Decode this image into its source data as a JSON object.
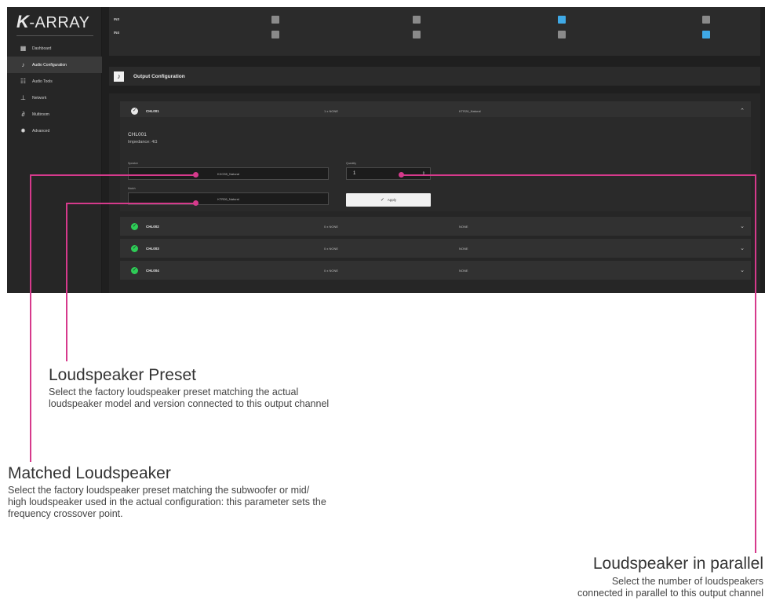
{
  "brand": {
    "logo_k": "K",
    "logo_text": "-ARRAY"
  },
  "sidebar": {
    "items": [
      {
        "label": "Dashboard",
        "icon": "dashboard-icon",
        "glyph": "▦",
        "active": false
      },
      {
        "label": "Audio Configuration",
        "icon": "music-note-icon",
        "glyph": "♪",
        "active": true
      },
      {
        "label": "Audio Tools",
        "icon": "tools-icon",
        "glyph": "☷",
        "active": false
      },
      {
        "label": "Network",
        "icon": "network-icon",
        "glyph": "⊥",
        "active": false
      },
      {
        "label": "Multiroom",
        "icon": "link-icon",
        "glyph": "∂",
        "active": false
      },
      {
        "label": "Advanced",
        "icon": "gear-icon",
        "glyph": "✹",
        "active": false
      }
    ]
  },
  "matrix": {
    "rows": [
      {
        "label": "IN3",
        "cells": [
          false,
          false,
          true,
          false
        ]
      },
      {
        "label": "IN4",
        "cells": [
          false,
          false,
          false,
          true
        ]
      }
    ],
    "colors": {
      "on": "#3fa9e6",
      "off": "#8a8a8a"
    }
  },
  "output_config": {
    "title": "Output Configuration",
    "channels": [
      {
        "name": "CHL001",
        "quantity": "1 x NONE",
        "preset": "KTR26_Natural",
        "status": "white",
        "expanded": true
      },
      {
        "name": "CHL002",
        "quantity": "0 x NONE",
        "preset": "NONE",
        "status": "green",
        "expanded": false
      },
      {
        "name": "CHL003",
        "quantity": "0 x NONE",
        "preset": "NONE",
        "status": "green",
        "expanded": false
      },
      {
        "name": "CHL004",
        "quantity": "0 x NONE",
        "preset": "NONE",
        "status": "green",
        "expanded": false
      }
    ],
    "detail": {
      "title": "CHL001",
      "impedance": "Impedance: 4Ω",
      "speaker_label": "Speaker",
      "speaker_value": "KXO35_Natural",
      "quantity_label": "Quantity",
      "quantity_value": "1",
      "match_label": "Match",
      "match_value": "KTR26_Natural",
      "apply_label": "Apply"
    }
  },
  "callout_color": "#d63a8c",
  "annotations": {
    "preset": {
      "title": "Loudspeaker Preset",
      "lines": [
        "Select the factory loudspeaker preset matching the actual",
        "loudspeaker model and version connected to this output channel"
      ]
    },
    "matched": {
      "title": "Matched Loudspeaker",
      "lines": [
        "Select the factory loudspeaker preset matching the subwoofer or mid/",
        "high loudspeaker used in the actual configuration: this parameter sets the",
        "frequency crossover point."
      ]
    },
    "parallel": {
      "title": "Loudspeaker in parallel",
      "lines": [
        "Select the number of loudspeakers",
        "connected in parallel to this output channel"
      ]
    }
  }
}
